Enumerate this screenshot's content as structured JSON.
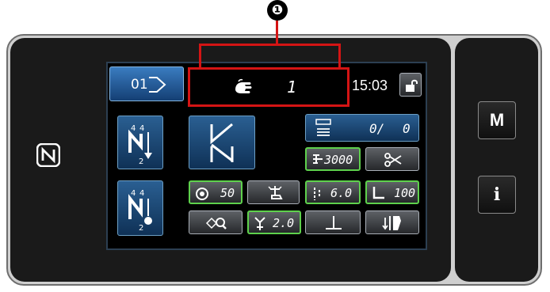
{
  "callout": {
    "number": "❶"
  },
  "header": {
    "pattern_number": "01",
    "status_count": "1",
    "time": "15:03"
  },
  "counter": {
    "value": "0/",
    "max": "0"
  },
  "values": {
    "speed": "3000",
    "stitch_count": "50",
    "stitch_length": "6.0",
    "presser_pressure": "100",
    "thread_tension": "2.0"
  },
  "side": {
    "menu_label": "M",
    "info_label": "i"
  },
  "nfc": {
    "label": "N"
  },
  "colors": {
    "accent_green": "#5ed14c",
    "callout_red": "#d41414",
    "button_blue": "#2a5f92"
  }
}
